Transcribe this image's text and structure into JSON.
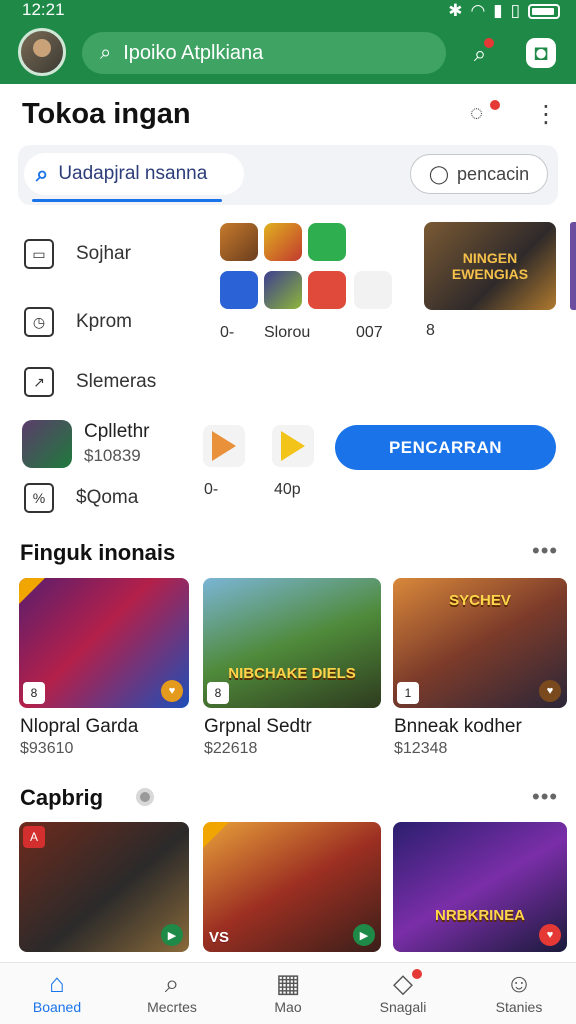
{
  "status_bar": {
    "time": "12:21"
  },
  "top_bar": {
    "search_text": "Ipoiko Atplkiana"
  },
  "store": {
    "title": "Tokoa ingan"
  },
  "search": {
    "field_text": "Uadapjral nsanna",
    "button_label": "pencacin"
  },
  "menu": [
    {
      "label": "Sojhar",
      "icon": "storefront-icon"
    },
    {
      "label": "Kprom",
      "icon": "clock-icon"
    },
    {
      "label": "Slemeras",
      "icon": "trend-icon"
    },
    {
      "label": "$Qoma",
      "icon": "discount-icon"
    }
  ],
  "app_grid": {
    "labels": [
      "0-",
      "Slorou",
      "007"
    ],
    "feature_text": "NINGEN EWENGIAS",
    "feature_badge": "8"
  },
  "promo": {
    "name": "Cpllethr",
    "price": "$10839",
    "play_labels": [
      "0-",
      "40p"
    ],
    "cta_label": "PENCARRAN"
  },
  "section1": {
    "title": "Finguk inonais",
    "more": "•••",
    "games": [
      {
        "name": "Nlopral Garda",
        "price": "$93610",
        "badge": "8",
        "caption": ""
      },
      {
        "name": "Grpnal Sedtr",
        "price": "$22618",
        "badge": "8",
        "caption": "NIBCHAKE DIELS"
      },
      {
        "name": "Bnneak kodher",
        "price": "$12348",
        "badge": "1",
        "caption": "SYCHEV"
      }
    ]
  },
  "section2": {
    "title": "Capbrig",
    "more": "•••",
    "games": [
      {
        "caption": "",
        "badge": "A"
      },
      {
        "caption": "VS",
        "badge": ""
      },
      {
        "caption": "NRBKRINEA",
        "badge": ""
      }
    ]
  },
  "bottom_nav": [
    {
      "label": "Boaned",
      "icon": "home-icon",
      "active": true
    },
    {
      "label": "Mecrtes",
      "icon": "search-icon",
      "active": false
    },
    {
      "label": "Mao",
      "icon": "calendar-icon",
      "active": false
    },
    {
      "label": "Snagali",
      "icon": "tag-icon",
      "active": false
    },
    {
      "label": "Stanies",
      "icon": "person-icon",
      "active": false
    }
  ],
  "colors": {
    "brand_green": "#1f8a47",
    "accent_blue": "#1a73e8",
    "notification_red": "#e53935"
  }
}
